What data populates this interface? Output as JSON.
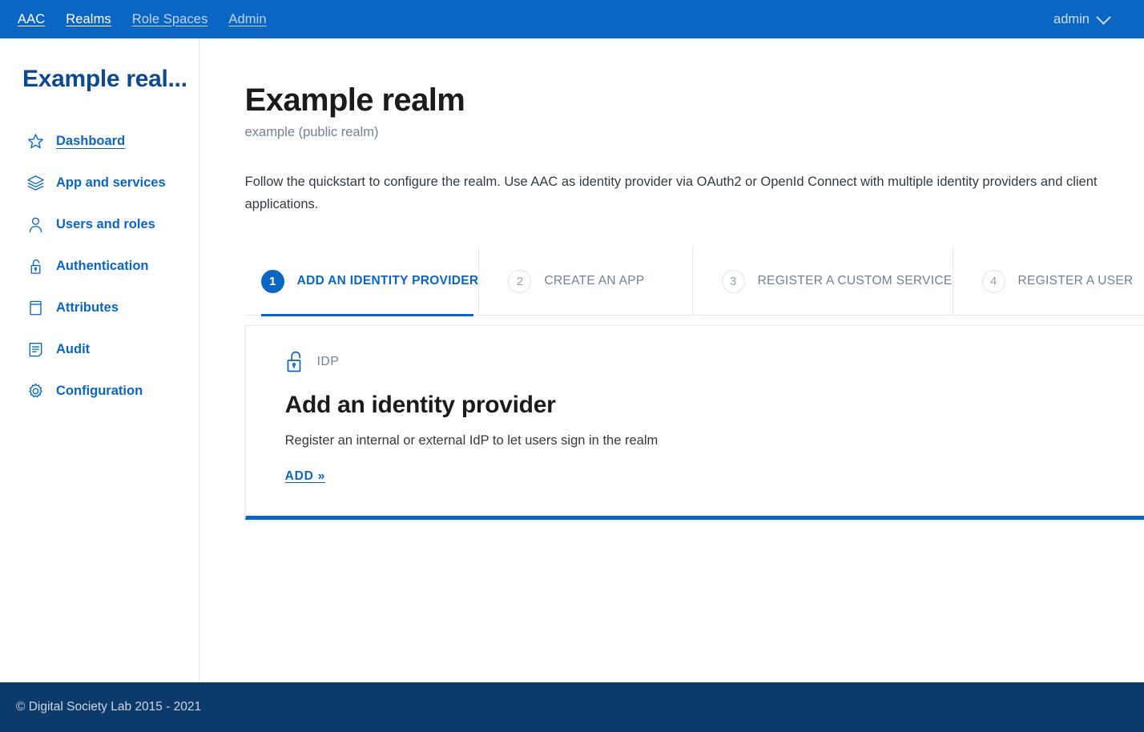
{
  "topbar": {
    "brand": "AAC",
    "links": [
      {
        "label": "Realms",
        "muted": false
      },
      {
        "label": "Role Spaces",
        "muted": true
      },
      {
        "label": "Admin",
        "muted": true
      }
    ],
    "user": "admin",
    "chevron_icon": "chevron-down-icon",
    "background_color": "#0a66c2"
  },
  "sidebar": {
    "realm_title": "Example real...",
    "items": [
      {
        "label": "Dashboard",
        "icon": "star-icon",
        "active": true
      },
      {
        "label": "App and services",
        "icon": "layers-icon",
        "active": false
      },
      {
        "label": "Users and roles",
        "icon": "user-icon",
        "active": false
      },
      {
        "label": "Authentication",
        "icon": "unlock-icon",
        "active": false
      },
      {
        "label": "Attributes",
        "icon": "database-icon",
        "active": false
      },
      {
        "label": "Audit",
        "icon": "document-icon",
        "active": false
      },
      {
        "label": "Configuration",
        "icon": "gear-icon",
        "active": false
      }
    ],
    "accent_color": "#0a66c2"
  },
  "main": {
    "title": "Example realm",
    "subtitle": "example (public realm)",
    "description": "Follow the quickstart to configure the realm. Use AAC as identity provider via OAuth2 or OpenId Connect with multiple identity providers and client applications.",
    "steps": [
      {
        "number": "1",
        "label": "ADD AN IDENTITY PROVIDER",
        "active": true
      },
      {
        "number": "2",
        "label": "CREATE AN APP",
        "active": false
      },
      {
        "number": "3",
        "label": "REGISTER A CUSTOM SERVICE",
        "active": false
      },
      {
        "number": "4",
        "label": "REGISTER A USER",
        "active": false
      }
    ],
    "card": {
      "icon": "unlock-icon",
      "kicker": "IDP",
      "title": "Add an identity provider",
      "description": "Register an internal or external IdP to let users sign in the realm",
      "action_label": "ADD »",
      "accent_color": "#0a66c2"
    }
  },
  "footer": {
    "copyright": "© Digital Society Lab 2015 - 2021",
    "background_color": "#0b3a6b"
  }
}
